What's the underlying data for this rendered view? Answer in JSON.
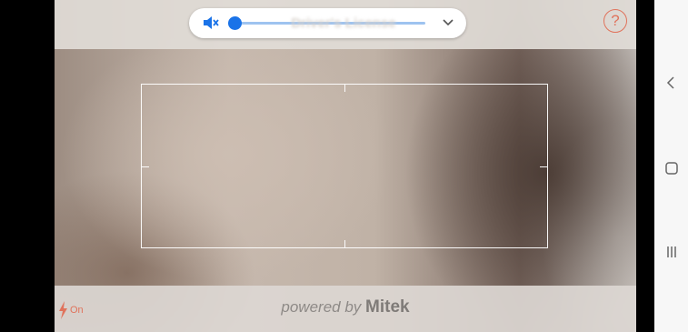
{
  "volume": {
    "ghost_text": "Driver's License",
    "level": 0.0
  },
  "camera": {
    "help_label": "?",
    "flash_label": "On",
    "brand_prefix": "powered by",
    "brand_name": "Mitek"
  },
  "colors": {
    "accent": "#1a73e8",
    "warning": "#e0735c"
  },
  "icons": [
    "mute-icon",
    "chevron-down-icon",
    "help-icon",
    "flash-icon",
    "back-icon",
    "home-icon",
    "recents-icon"
  ]
}
